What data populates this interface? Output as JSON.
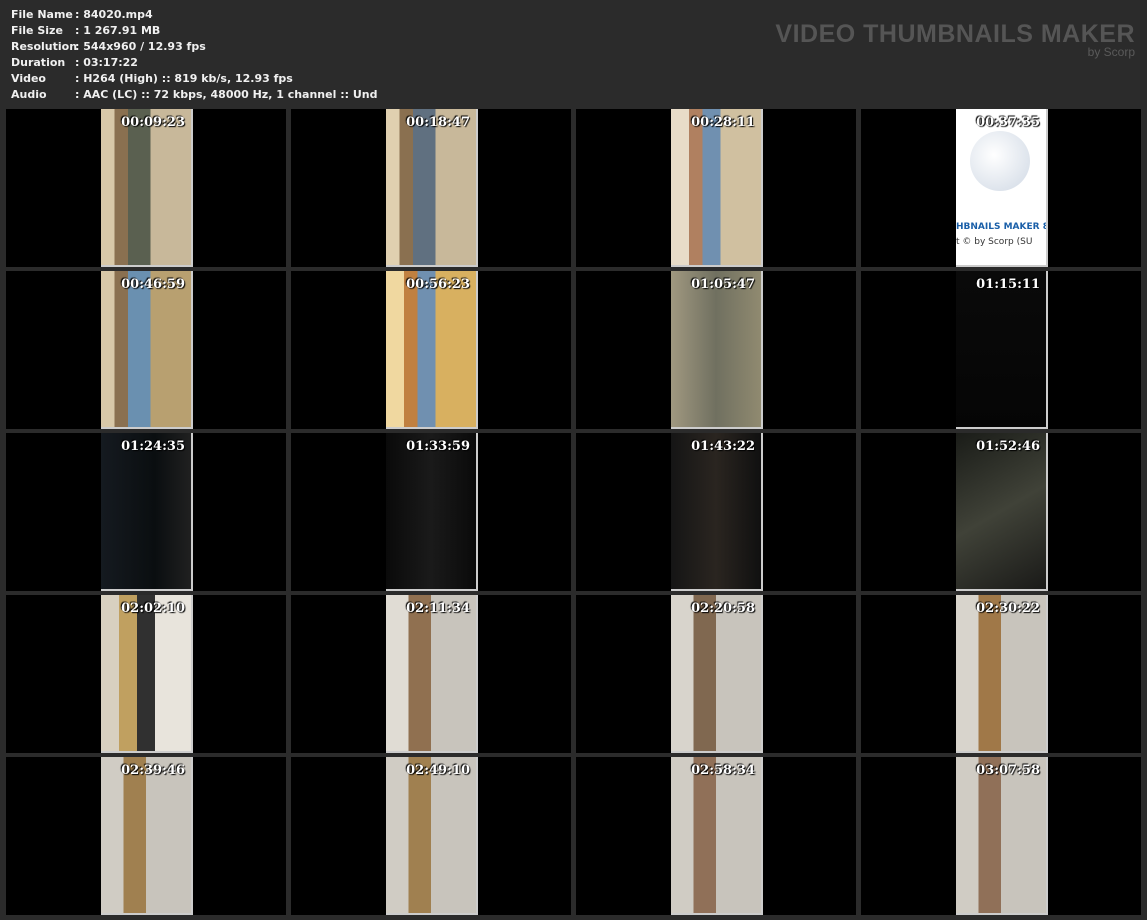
{
  "info": [
    {
      "label": "File Name",
      "value": ": 84020.mp4"
    },
    {
      "label": "File Size",
      "value": ": 1 267.91 MB"
    },
    {
      "label": "Resolution",
      "value": ": 544x960 / 12.93 fps"
    },
    {
      "label": "Duration",
      "value": ": 03:17:22"
    },
    {
      "label": "Video",
      "value": ": H264 (High) :: 819 kb/s, 12.93 fps"
    },
    {
      "label": "Audio",
      "value": ": AAC (LC) :: 72 kbps, 48000 Hz, 1 channel :: Und"
    }
  ],
  "logo": {
    "title": "VIDEO THUMBNAILS MAKER",
    "by": "by Scorp"
  },
  "owl": {
    "line1": "HBNAILS MAKER 8",
    "line2": "t © by Scorp (SU"
  },
  "thumbs": [
    {
      "time": "00:09:23",
      "bg": "linear-gradient(90deg,#d8c8a8 0 15%,#8a7050 15% 30%,#5a6050 30% 55%,#c8b89a 55%)"
    },
    {
      "time": "00:18:47",
      "bg": "linear-gradient(90deg,#e0d0b0 0 15%,#8a7050 15% 30%,#607080 30% 55%,#c8b89a 55%)"
    },
    {
      "time": "00:28:11",
      "bg": "linear-gradient(90deg,#e8dcc8 0 20%,#b08060 20% 35%,#7090b0 35% 55%,#d0c0a0 55%)"
    },
    {
      "time": "00:37:35",
      "owl": true
    },
    {
      "time": "00:46:59",
      "bg": "linear-gradient(90deg,#d8c8a8 0 15%,#8a7050 15% 30%,#6a90b0 30% 55%,#b8a070 55%)"
    },
    {
      "time": "00:56:23",
      "bg": "linear-gradient(90deg,#f0d8a0 0 20%,#c08040 20% 35%,#7090b0 35% 55%,#d8b060 55%)"
    },
    {
      "time": "01:05:47",
      "bg": "linear-gradient(90deg,#a09880,#707060 50%,#908a70)"
    },
    {
      "time": "01:15:11",
      "bg": "linear-gradient(180deg,#0a0a0a,#050505)"
    },
    {
      "time": "01:24:35",
      "bg": "linear-gradient(90deg,#151a20,#0a0e10 60%,#202020)"
    },
    {
      "time": "01:33:59",
      "bg": "linear-gradient(90deg,#0a0a0a,#1a1a1a 50%,#0a0a0a)"
    },
    {
      "time": "01:43:22",
      "bg": "linear-gradient(90deg,#151515,#2a2520 50%,#101010)"
    },
    {
      "time": "01:52:46",
      "bg": "linear-gradient(150deg,#1a1c18,#404238 50%,#1a1a18)"
    },
    {
      "time": "02:02:10",
      "bg": "linear-gradient(90deg,#d8d0c0 0 20%,#c0a060 20% 40%,#303030 40% 60%,#e8e4dc 60%)"
    },
    {
      "time": "02:11:34",
      "bg": "linear-gradient(90deg,#e0dcd4 0 25%,#907050 25% 50%,#c8c4bc 50%)"
    },
    {
      "time": "02:20:58",
      "bg": "linear-gradient(90deg,#d8d4cc 0 25%,#806850 25% 50%,#c8c4bc 50%)"
    },
    {
      "time": "02:30:22",
      "bg": "linear-gradient(90deg,#d8d4cc 0 25%,#a07848 25% 50%,#c8c4bc 50%)"
    },
    {
      "time": "02:39:46",
      "bg": "linear-gradient(90deg,#d0ccc4 0 25%,#a08050 25% 50%,#c8c4bc 50%)"
    },
    {
      "time": "02:49:10",
      "bg": "linear-gradient(90deg,#d0ccc4 0 25%,#a08050 25% 50%,#c8c4bc 50%)"
    },
    {
      "time": "02:58:34",
      "bg": "linear-gradient(90deg,#d0ccc4 0 25%,#907058 25% 50%,#c8c4bc 50%)"
    },
    {
      "time": "03:07:58",
      "bg": "linear-gradient(90deg,#d0ccc4 0 25%,#907058 25% 50%,#c8c4bc 50%)"
    }
  ]
}
